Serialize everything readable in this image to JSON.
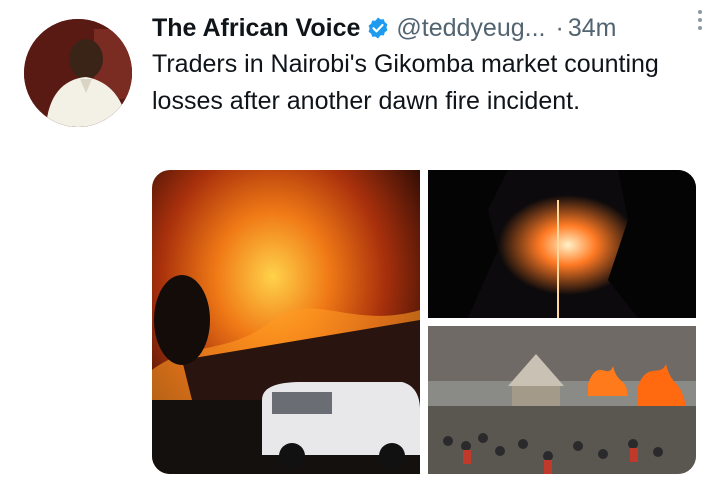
{
  "tweet": {
    "display_name": "The African Voice",
    "handle": "@teddyeug...",
    "separator": "·",
    "time": "34m",
    "text": "Traders in Nairobi's Gikomba market counting losses after another dawn fire incident.",
    "accent_color": "#1d9bf0"
  },
  "icons": {
    "verified": "verified-badge-icon",
    "more": "more-options-icon"
  },
  "media": [
    {
      "name": "photo-fire-night-building"
    },
    {
      "name": "photo-fire-night-silhouette"
    },
    {
      "name": "photo-fire-market-aftermath"
    }
  ]
}
